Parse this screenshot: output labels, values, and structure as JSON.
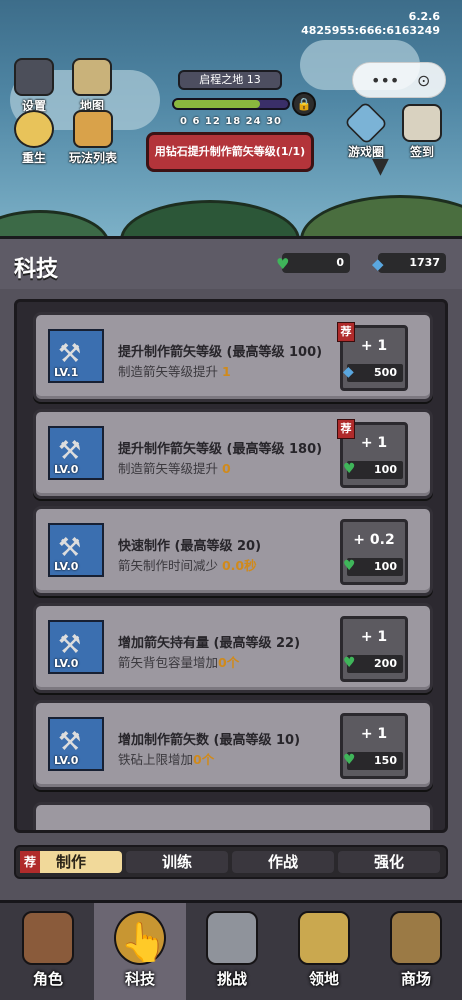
{
  "version": "6.2.6",
  "session_id": "4825955:666:6163249",
  "top_left": [
    {
      "label": "设置",
      "icon": "menu-icon"
    },
    {
      "label": "地图",
      "icon": "map-icon"
    },
    {
      "label": "重生",
      "icon": "rebirth-icon"
    },
    {
      "label": "玩法列表",
      "icon": "list-icon"
    }
  ],
  "stage": {
    "name": "启程之地 13",
    "ticks": "0   6  12  18 24 30",
    "progress": 0.75,
    "gem_button": "用钻石提升制作箭矢等级(1/1)"
  },
  "top_right": [
    {
      "label": "游戏圈",
      "icon": "game-circle-icon"
    },
    {
      "label": "签到",
      "icon": "checkin-icon"
    }
  ],
  "capsule": {
    "more": "•••",
    "close": "⊙"
  },
  "panel": {
    "title": "科技",
    "green_currency": "0",
    "gem_currency": "1737"
  },
  "upgrades": [
    {
      "title": "提升制作箭矢等级 (最高等级 100)",
      "desc": "制造箭矢等级提升 ",
      "value": "1",
      "level": "LV.1",
      "plus": "+ 1",
      "cost": "500",
      "cost_type": "gem",
      "recommended": true
    },
    {
      "title": "提升制作箭矢等级 (最高等级 180)",
      "desc": "制造箭矢等级提升 ",
      "value": "0",
      "level": "LV.0",
      "plus": "+ 1",
      "cost": "100",
      "cost_type": "green",
      "recommended": true
    },
    {
      "title": "快速制作 (最高等级 20)",
      "desc": "箭矢制作时间减少 ",
      "value": "0.0秒",
      "level": "LV.0",
      "plus": "+ 0.2",
      "cost": "100",
      "cost_type": "green",
      "recommended": false
    },
    {
      "title": "增加箭矢持有量 (最高等级 22)",
      "desc": "箭矢背包容量增加",
      "value": "0个",
      "level": "LV.0",
      "plus": "+ 1",
      "cost": "200",
      "cost_type": "green",
      "recommended": false
    },
    {
      "title": "增加制作箭矢数 (最高等级 10)",
      "desc": "铁砧上限增加",
      "value": "0个",
      "level": "LV.0",
      "plus": "+ 1",
      "cost": "150",
      "cost_type": "green",
      "recommended": false
    }
  ],
  "tabs": {
    "rec_badge": "荐",
    "items": [
      "制作",
      "训练",
      "作战",
      "强化"
    ],
    "active": 0
  },
  "rec_badge": "荐",
  "bottom_nav": [
    {
      "label": "角色",
      "icon": "character-icon"
    },
    {
      "label": "科技",
      "icon": "tech-icon"
    },
    {
      "label": "挑战",
      "icon": "challenge-icon"
    },
    {
      "label": "领地",
      "icon": "territory-icon"
    },
    {
      "label": "商场",
      "icon": "shop-icon"
    }
  ],
  "colors": {
    "accent_value": "#d08a1b",
    "green": "#3fb55a",
    "gem": "#5aa7e0",
    "red_button": "#b3343a",
    "active_tab": "#f1d99a"
  }
}
